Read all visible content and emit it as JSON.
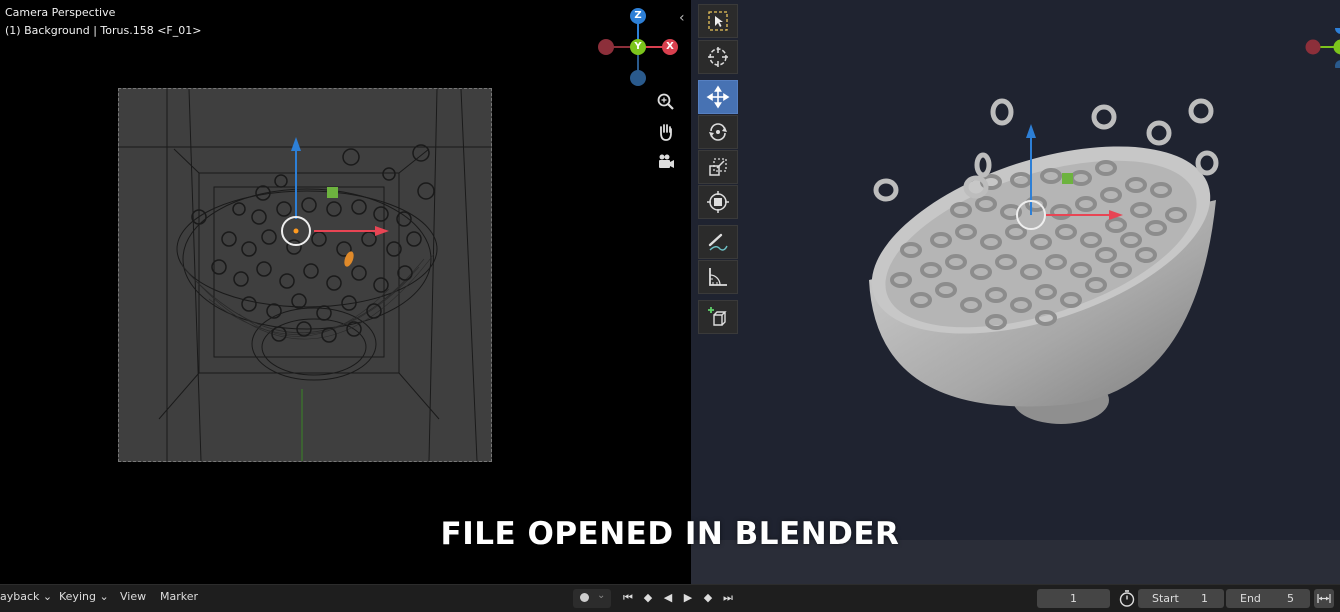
{
  "left_viewport": {
    "mode_label": "Camera Perspective",
    "object_label": "(1) Background | Torus.158 <F_01>",
    "collapse_arrow": "‹"
  },
  "gizmo": {
    "z": "Z",
    "y": "Y",
    "x": "X",
    "x_color": "#d9404f",
    "y_color": "#7cc41c",
    "z_color": "#2d7fd6"
  },
  "nav_icons": [
    "zoom-icon",
    "hand-pan-icon",
    "camera-icon"
  ],
  "toolbar": {
    "tools": [
      {
        "name": "select-box-tool",
        "active": false
      },
      {
        "name": "cursor-tool",
        "active": false
      },
      {
        "name": "move-tool",
        "active": true
      },
      {
        "name": "rotate-tool",
        "active": false
      },
      {
        "name": "scale-tool",
        "active": false
      },
      {
        "name": "transform-tool",
        "active": false
      },
      {
        "name": "annotate-tool",
        "active": false
      },
      {
        "name": "measure-tool",
        "active": false
      },
      {
        "name": "add-cube-tool",
        "active": false
      }
    ],
    "accent": "#4772b3"
  },
  "caption": "FILE OPENED IN BLENDER",
  "timeline": {
    "menus": [
      "ayback",
      "Keying",
      "View",
      "Marker"
    ],
    "current_frame": "1",
    "start_label": "Start",
    "start_value": "1",
    "end_label": "End",
    "end_value": "5",
    "dropdown_arrow": "⌄"
  }
}
